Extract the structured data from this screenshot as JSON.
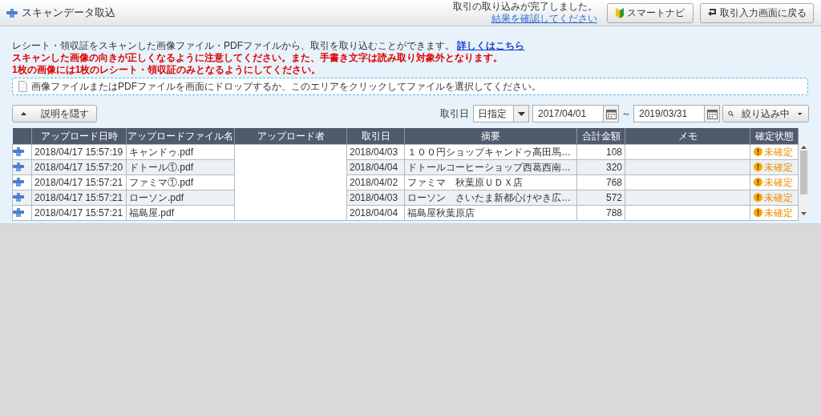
{
  "header": {
    "title": "スキャンデータ取込",
    "notice": "取引の取り込みが完了しました。",
    "notice_link": "結果を確認してください",
    "buttons": [
      "スマートナビ",
      "取引入力画面に戻る"
    ]
  },
  "info": {
    "text": "レシート・領収証をスキャンした画像ファイル・PDFファイルから、取引を取り込むことができます。",
    "link": "詳しくはこちら",
    "warnings": [
      "スキャンした画像の向きが正しくなるように注意してください。また、手書き文字は読み取り対象外となります。",
      "1枚の画像には1枚のレシート・領収証のみとなるようにしてください。"
    ],
    "dropzone": "画像ファイルまたはPDFファイルを画面にドロップするか、このエリアをクリックしてファイルを選択してください。"
  },
  "toolbar": {
    "toggle_button": "説明を隠す",
    "date_label": "取引日",
    "date_mode": "日指定",
    "date_from": "2017/04/01",
    "separator": "～",
    "date_to": "2019/03/31",
    "filter_button": "絞り込み中"
  },
  "table": {
    "columns": [
      "アップロード日時",
      "アップロードファイル名",
      "アップロード者",
      "取引日",
      "摘要",
      "合計金額",
      "メモ",
      "確定状態"
    ],
    "rows": [
      {
        "uploaded": "2018/04/17 15:57:19",
        "file": "キャンドゥ.pdf",
        "date": "2018/04/03",
        "summary": "１００円ショップキャンドゥ高田馬…",
        "amount": "108",
        "status": "未確定"
      },
      {
        "uploaded": "2018/04/17 15:57:20",
        "file": "ドトール①.pdf",
        "date": "2018/04/04",
        "summary": "ドトールコーヒーショップ西葛西南…",
        "amount": "320",
        "status": "未確定"
      },
      {
        "uploaded": "2018/04/17 15:57:21",
        "file": "ファミマ①.pdf",
        "date": "2018/04/02",
        "summary": "ファミマ　秋葉原ＵＤＸ店",
        "amount": "768",
        "status": "未確定"
      },
      {
        "uploaded": "2018/04/17 15:57:21",
        "file": "ローソン.pdf",
        "date": "2018/04/03",
        "summary": "ローソン　さいたま新都心けやき広…",
        "amount": "572",
        "status": "未確定"
      },
      {
        "uploaded": "2018/04/17 15:57:21",
        "file": "福島屋.pdf",
        "date": "2018/04/04",
        "summary": "福島屋秋葉原店",
        "amount": "788",
        "status": "未確定"
      }
    ]
  }
}
